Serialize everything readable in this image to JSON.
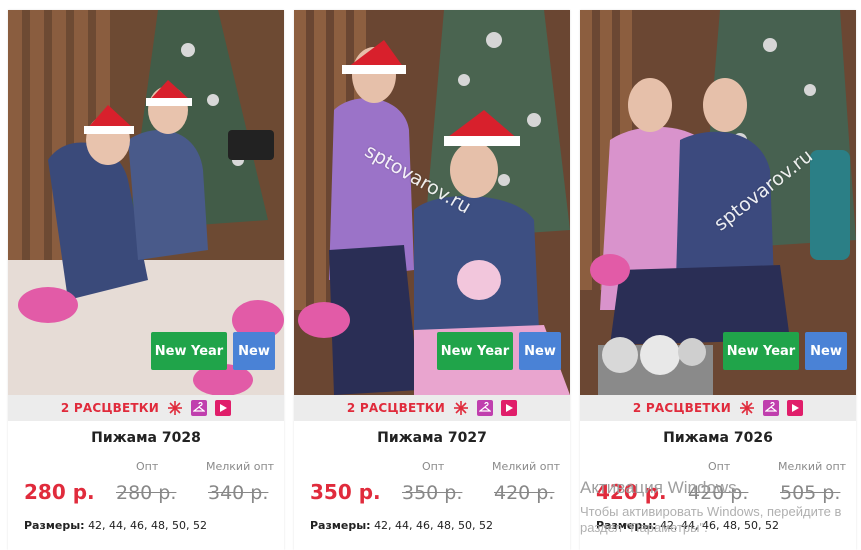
{
  "products": [
    {
      "title": "Пижама 7028",
      "variants": "2 РАСЦВЕТКИ",
      "badge_new_year": "New Year",
      "badge_new": "New",
      "price": "280 р.",
      "opt_label": "Опт",
      "opt_price": "280 р.",
      "small_opt_label": "Мелкий опт",
      "small_opt_price": "340 р.",
      "sizes_label": "Размеры:",
      "sizes": "42, 44, 46, 48, 50, 52"
    },
    {
      "title": "Пижама 7027",
      "variants": "2 РАСЦВЕТКИ",
      "badge_new_year": "New Year",
      "badge_new": "New",
      "price": "350 р.",
      "opt_label": "Опт",
      "opt_price": "350 р.",
      "small_opt_label": "Мелкий опт",
      "small_opt_price": "420 р.",
      "sizes_label": "Размеры:",
      "sizes": "42, 44, 46, 48, 50, 52",
      "watermark": "sptovarov.ru"
    },
    {
      "title": "Пижама 7026",
      "variants": "2 РАСЦВЕТКИ",
      "badge_new_year": "New Year",
      "badge_new": "New",
      "price": "420 р.",
      "opt_label": "Опт",
      "opt_price": "420 р.",
      "small_opt_label": "Мелкий опт",
      "small_opt_price": "505 р.",
      "sizes_label": "Размеры:",
      "sizes": "42, 44, 46, 48, 50, 52",
      "watermark": "sptovarov.ru"
    }
  ],
  "windows_activation": {
    "title": "Активация Windows",
    "text": "Чтобы активировать Windows, перейдите в раздел \"Параметры\"."
  },
  "colors": {
    "price_red": "#e02b3c",
    "badge_green": "#20a44a",
    "badge_blue": "#4a82d6",
    "strip_bg": "#ececec"
  },
  "icons": [
    "sparkle-icon",
    "hanger-icon",
    "play-video-icon"
  ]
}
